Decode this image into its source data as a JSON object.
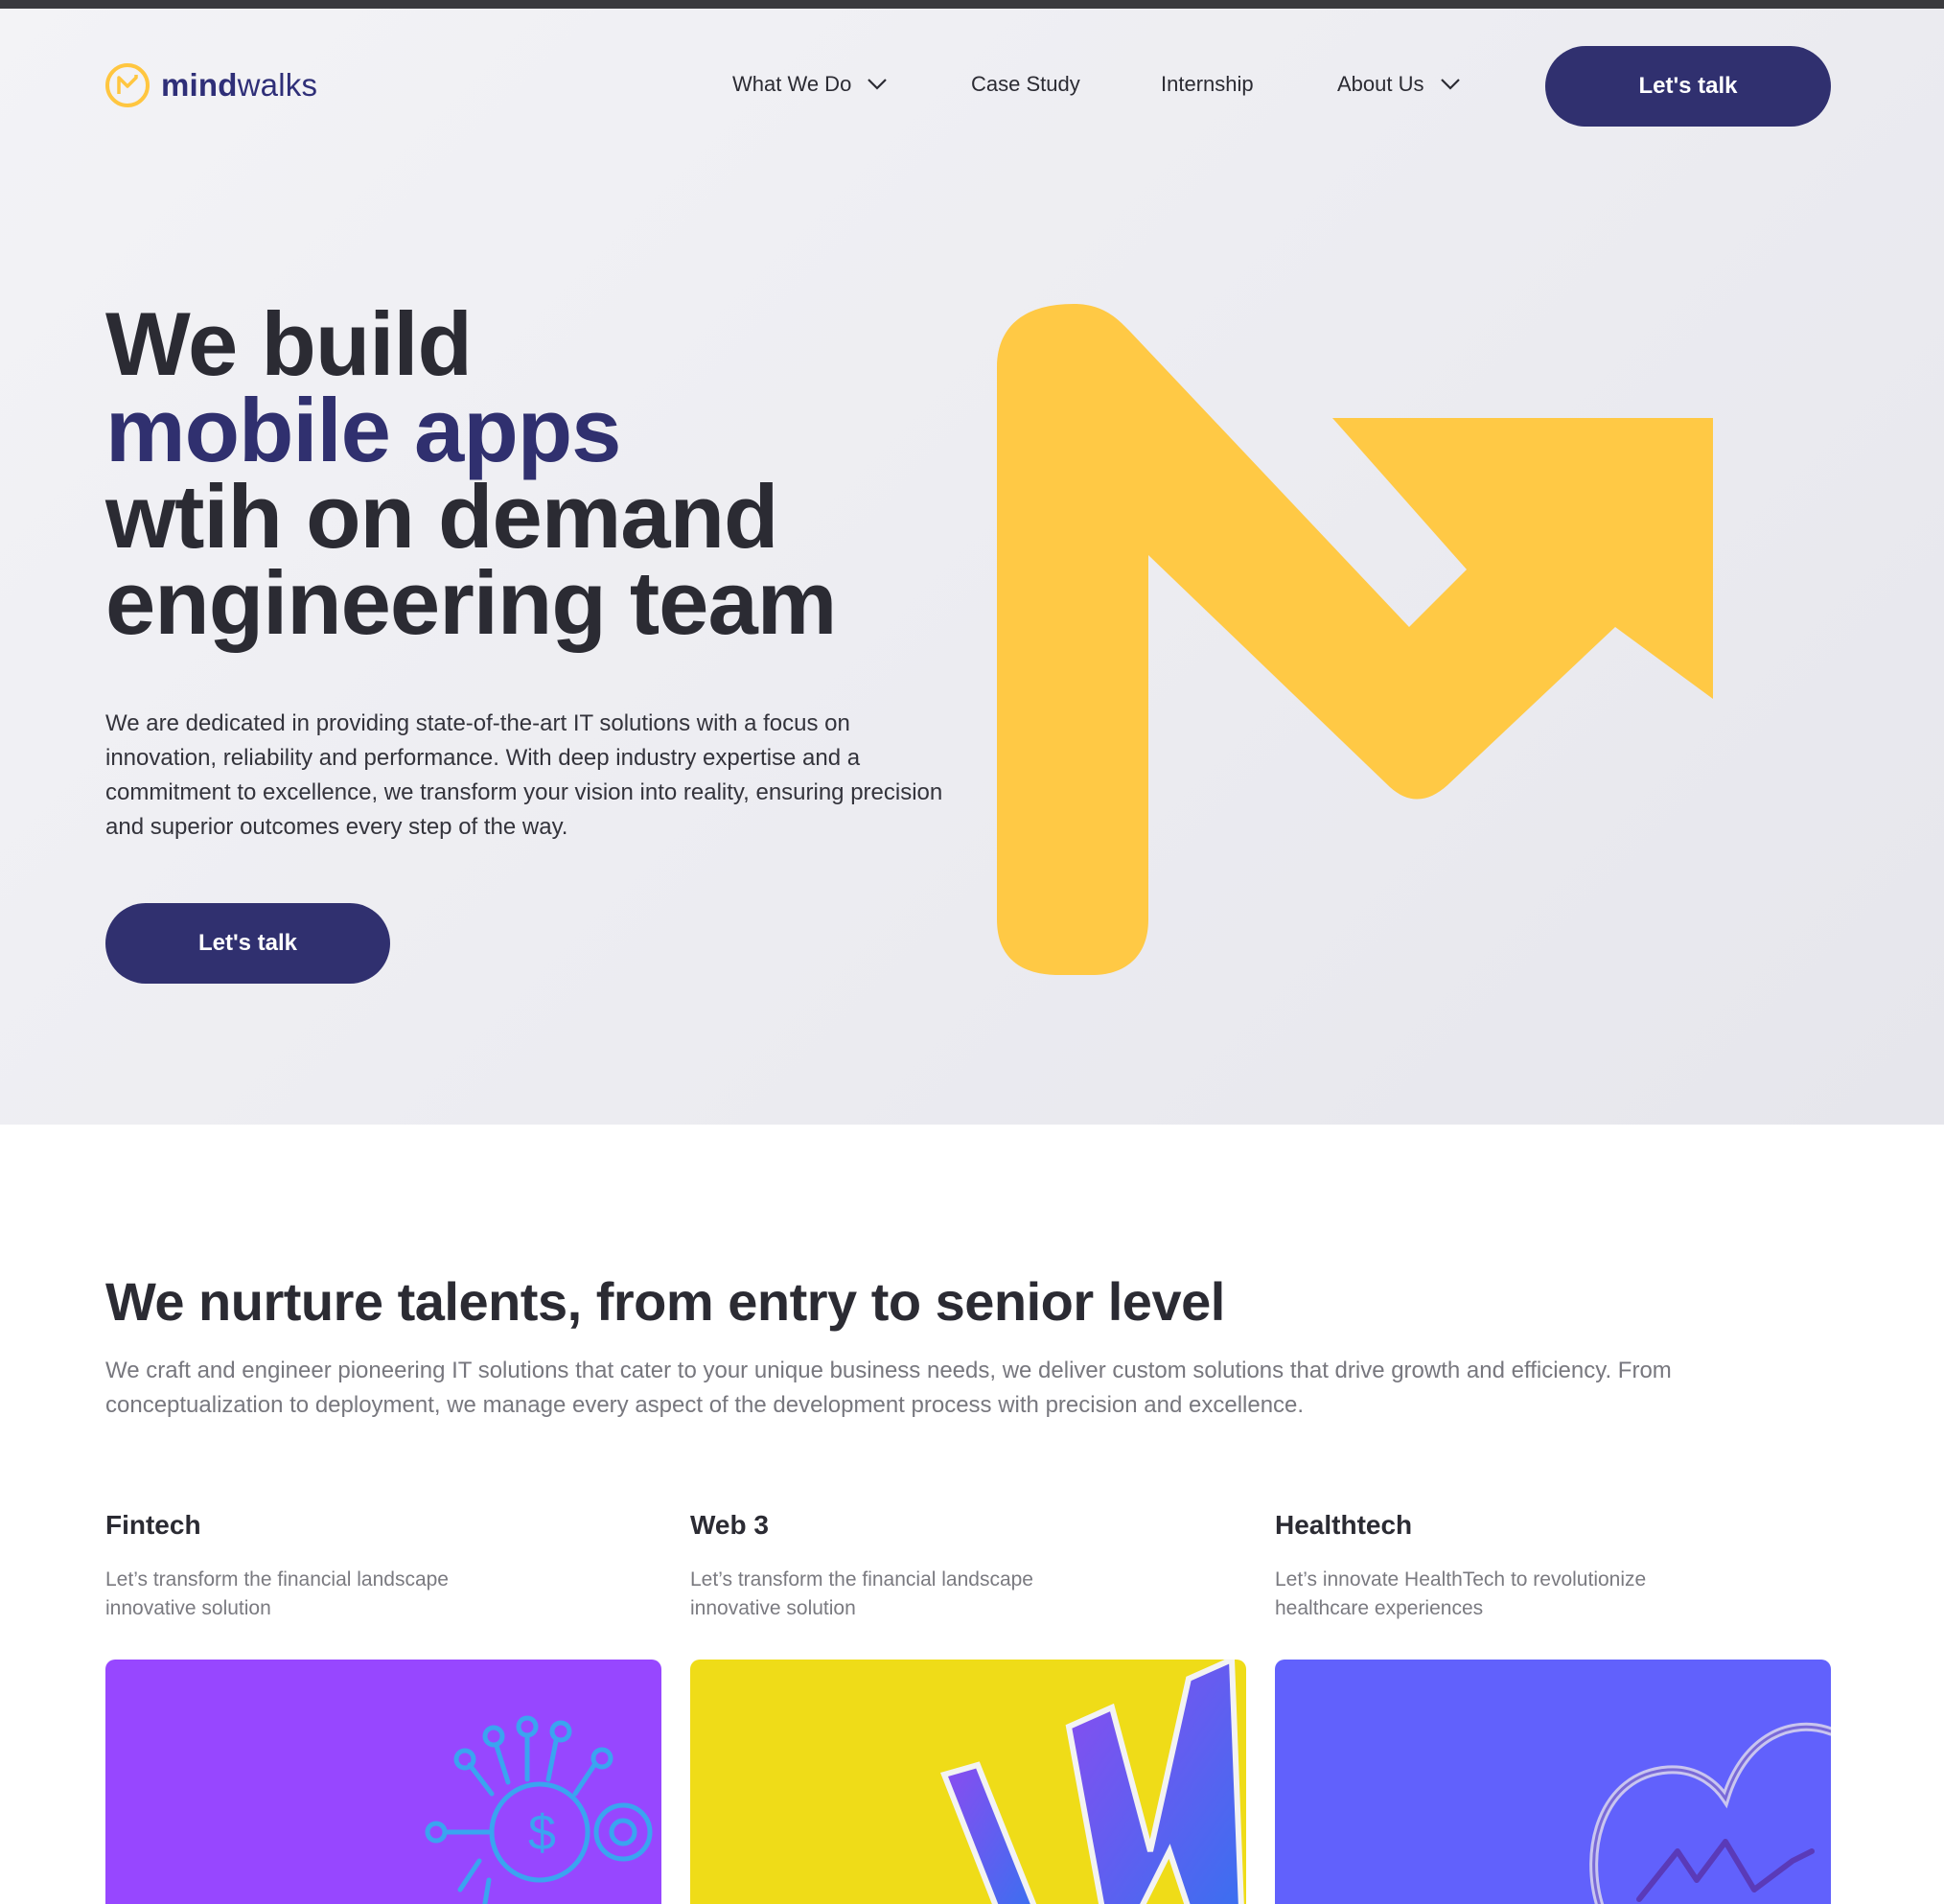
{
  "brand": {
    "logo_bold": "mind",
    "logo_regular": "walks"
  },
  "nav": {
    "items": [
      {
        "label": "What We Do",
        "dropdown": true
      },
      {
        "label": "Case Study",
        "dropdown": false
      },
      {
        "label": "Internship",
        "dropdown": false
      },
      {
        "label": "About Us",
        "dropdown": true
      }
    ],
    "cta": "Let's talk"
  },
  "hero": {
    "title_line1": "We build",
    "title_line2": "mobile apps",
    "title_line3": "wtih on demand",
    "title_line4": "engineering team",
    "description": "We are dedicated in providing state-of-the-art IT solutions with a focus on innovation, reliability and performance. With deep industry expertise and a commitment to excellence, we transform your vision into reality, ensuring precision and superior outcomes every step of the way.",
    "cta": "Let's talk"
  },
  "section": {
    "title": "We nurture talents, from entry to senior level",
    "description": "We craft and engineer pioneering IT solutions that cater to your unique business needs, we deliver custom solutions that drive growth and efficiency. From conceptualization to deployment, we manage every aspect of the development process with precision and excellence.",
    "cards": [
      {
        "title": "Fintech",
        "subtitle": "Let’s transform the financial landscape innovative solution",
        "color": "#9747ff",
        "icon": "fintech-bulb-gear-icon"
      },
      {
        "title": "Web 3",
        "subtitle": "Let’s transform the financial landscape innovative solution",
        "color": "#efdc18",
        "icon": "web3-w-icon"
      },
      {
        "title": "Healthtech",
        "subtitle": "Let’s innovate HealthTech to revolutionize healthcare experiences",
        "color": "#6161fc",
        "icon": "heart-pulse-icon"
      }
    ]
  },
  "colors": {
    "primary": "#30306f",
    "accent": "#ffc640",
    "text": "#2b2b33"
  }
}
